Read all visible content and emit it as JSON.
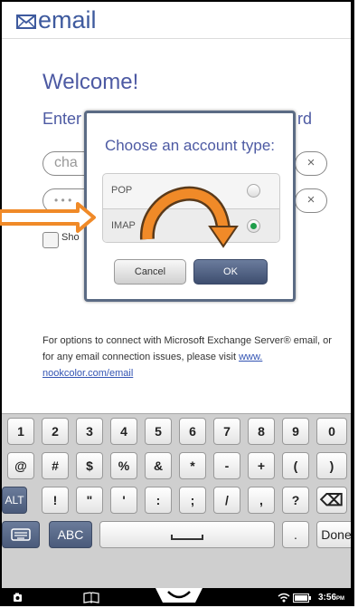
{
  "header": {
    "title": "email"
  },
  "setup": {
    "welcome": "Welcome!",
    "enter_prefix": "Enter",
    "enter_suffix": "rd",
    "email_value": "cha",
    "password_value": "• • •",
    "clear_symbol": "×",
    "show_password_label": "Sho"
  },
  "dialog": {
    "title": "Choose an account type:",
    "options": [
      {
        "label": "POP",
        "selected": false
      },
      {
        "label": "IMAP",
        "selected": true
      }
    ],
    "cancel_label": "Cancel",
    "ok_label": "OK"
  },
  "info": {
    "text": "For options to connect with Microsoft Exchange Server® email, or for any email connection issues, please visit ",
    "link": "www. nookcolor.com/email"
  },
  "keyboard": {
    "row1": [
      "1",
      "2",
      "3",
      "4",
      "5",
      "6",
      "7",
      "8",
      "9",
      "0"
    ],
    "row2": [
      "@",
      "#",
      "$",
      "%",
      "&",
      "*",
      "-",
      "+",
      "(",
      ")"
    ],
    "row3": [
      "ALT",
      "!",
      "\"",
      "'",
      ":",
      ";",
      "/",
      ",",
      "?",
      "⌫"
    ],
    "row4": {
      "abc": "ABC",
      "period": ".",
      "done": "Done"
    }
  },
  "statusbar": {
    "time": "3:56",
    "ampm": "PM"
  },
  "colors": {
    "accent": "#4d5aa3",
    "ok_button": "#4e5e7f",
    "arrow": "#f08a28",
    "radio_selected": "#1e9e4a"
  }
}
